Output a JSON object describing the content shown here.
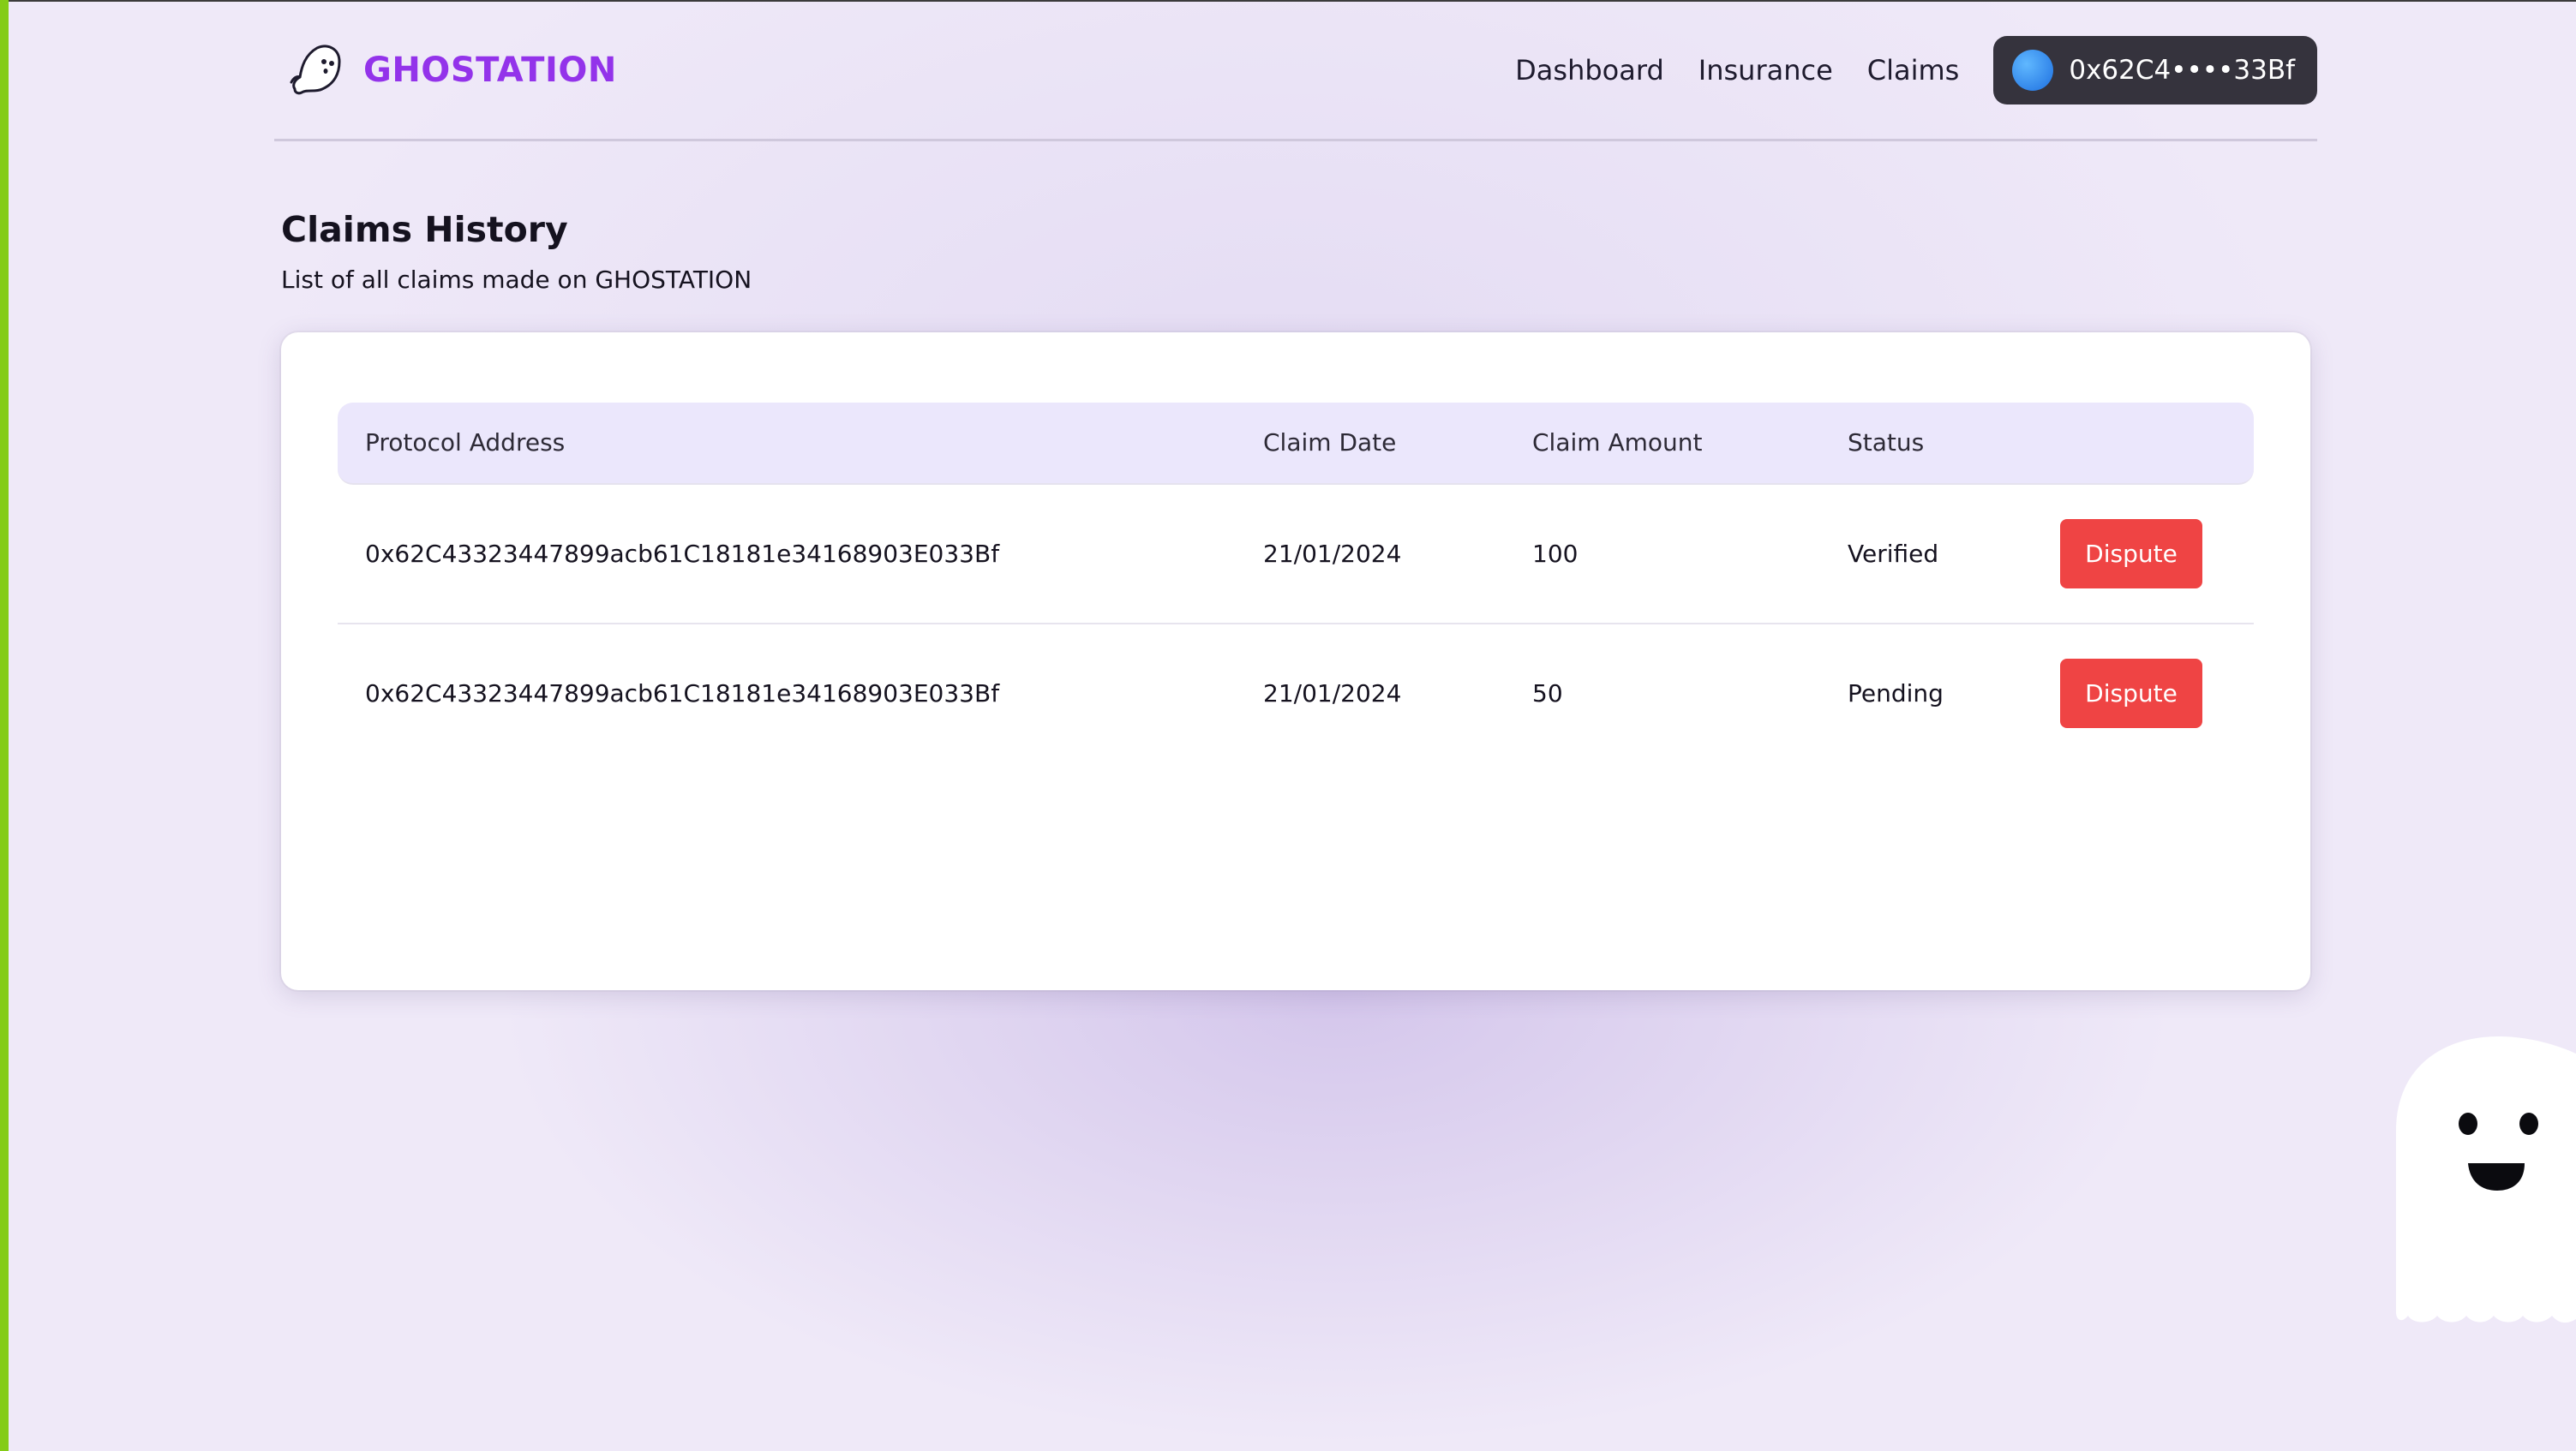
{
  "brand": {
    "name": "GHOSTATION",
    "logo_icon": "ghost-icon",
    "color": "#9333ea"
  },
  "nav": {
    "links": [
      "Dashboard",
      "Insurance",
      "Claims"
    ],
    "wallet": {
      "avatar_icon": "wallet-avatar",
      "address": "0x62C4••••33Bf"
    }
  },
  "page": {
    "title": "Claims History",
    "subtitle": "List of all claims made on GHOSTATION"
  },
  "table": {
    "columns": [
      "Protocol Address",
      "Claim Date",
      "Claim Amount",
      "Status"
    ],
    "rows": [
      {
        "address": "0x62C43323447899acb61C18181e34168903E033Bf",
        "date": "21/01/2024",
        "amount": "100",
        "status": "Verified",
        "action": "Dispute"
      },
      {
        "address": "0x62C43323447899acb61C18181e34168903E033Bf",
        "date": "21/01/2024",
        "amount": "50",
        "status": "Pending",
        "action": "Dispute"
      }
    ]
  },
  "colors": {
    "accent_bar": "#84cc16",
    "dispute_button": "#ef4444",
    "table_header": "#ebe7fc",
    "wallet_bg": "#35333d"
  },
  "decorations": {
    "mascot_icon": "ghost-mascot-icon"
  }
}
